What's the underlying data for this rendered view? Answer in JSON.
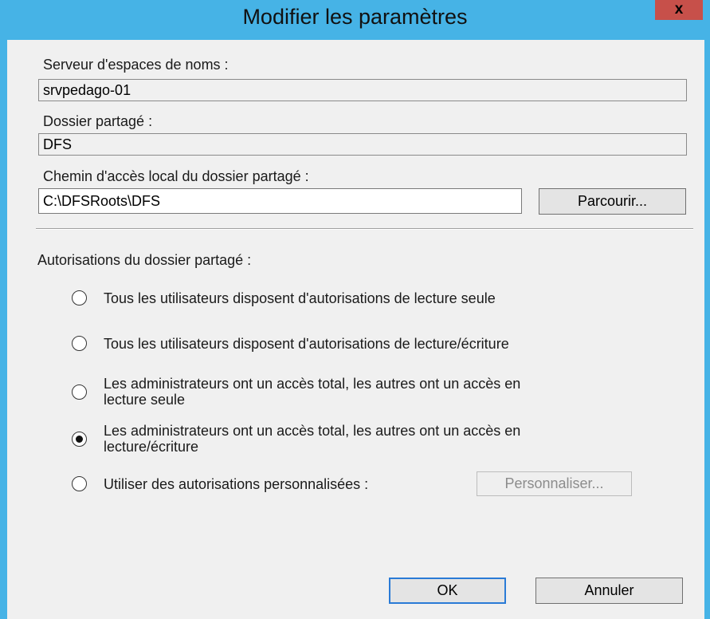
{
  "dialog": {
    "title": "Modifier les paramètres",
    "close_glyph": "x"
  },
  "namespace_server": {
    "label": "Serveur d'espaces de noms :",
    "value": "srvpedago-01"
  },
  "shared_folder": {
    "label": "Dossier partagé :",
    "value": "DFS"
  },
  "local_path": {
    "label": "Chemin d'accès local du dossier partagé :",
    "value": "C:\\DFSRoots\\DFS",
    "browse_label": "Parcourir..."
  },
  "permissions": {
    "label": "Autorisations du dossier partagé :",
    "selected_index": 3,
    "options": [
      {
        "lines": [
          "Tous les utilisateurs disposent d'autorisations de lecture seule"
        ]
      },
      {
        "lines": [
          "Tous les utilisateurs disposent d'autorisations de lecture/écriture"
        ]
      },
      {
        "lines": [
          "Les administrateurs ont un accès total, les autres ont un accès en",
          "lecture seule"
        ]
      },
      {
        "lines": [
          "Les administrateurs ont un accès total, les autres ont un accès en",
          "lecture/écriture"
        ]
      },
      {
        "lines": [
          "Utiliser des autorisations personnalisées :"
        ]
      }
    ],
    "customize_label": "Personnaliser..."
  },
  "buttons": {
    "ok": "OK",
    "cancel": "Annuler"
  },
  "colors": {
    "title_bar": "#46b3e6",
    "close_button": "#c7504a",
    "background": "#f0f0f0"
  }
}
